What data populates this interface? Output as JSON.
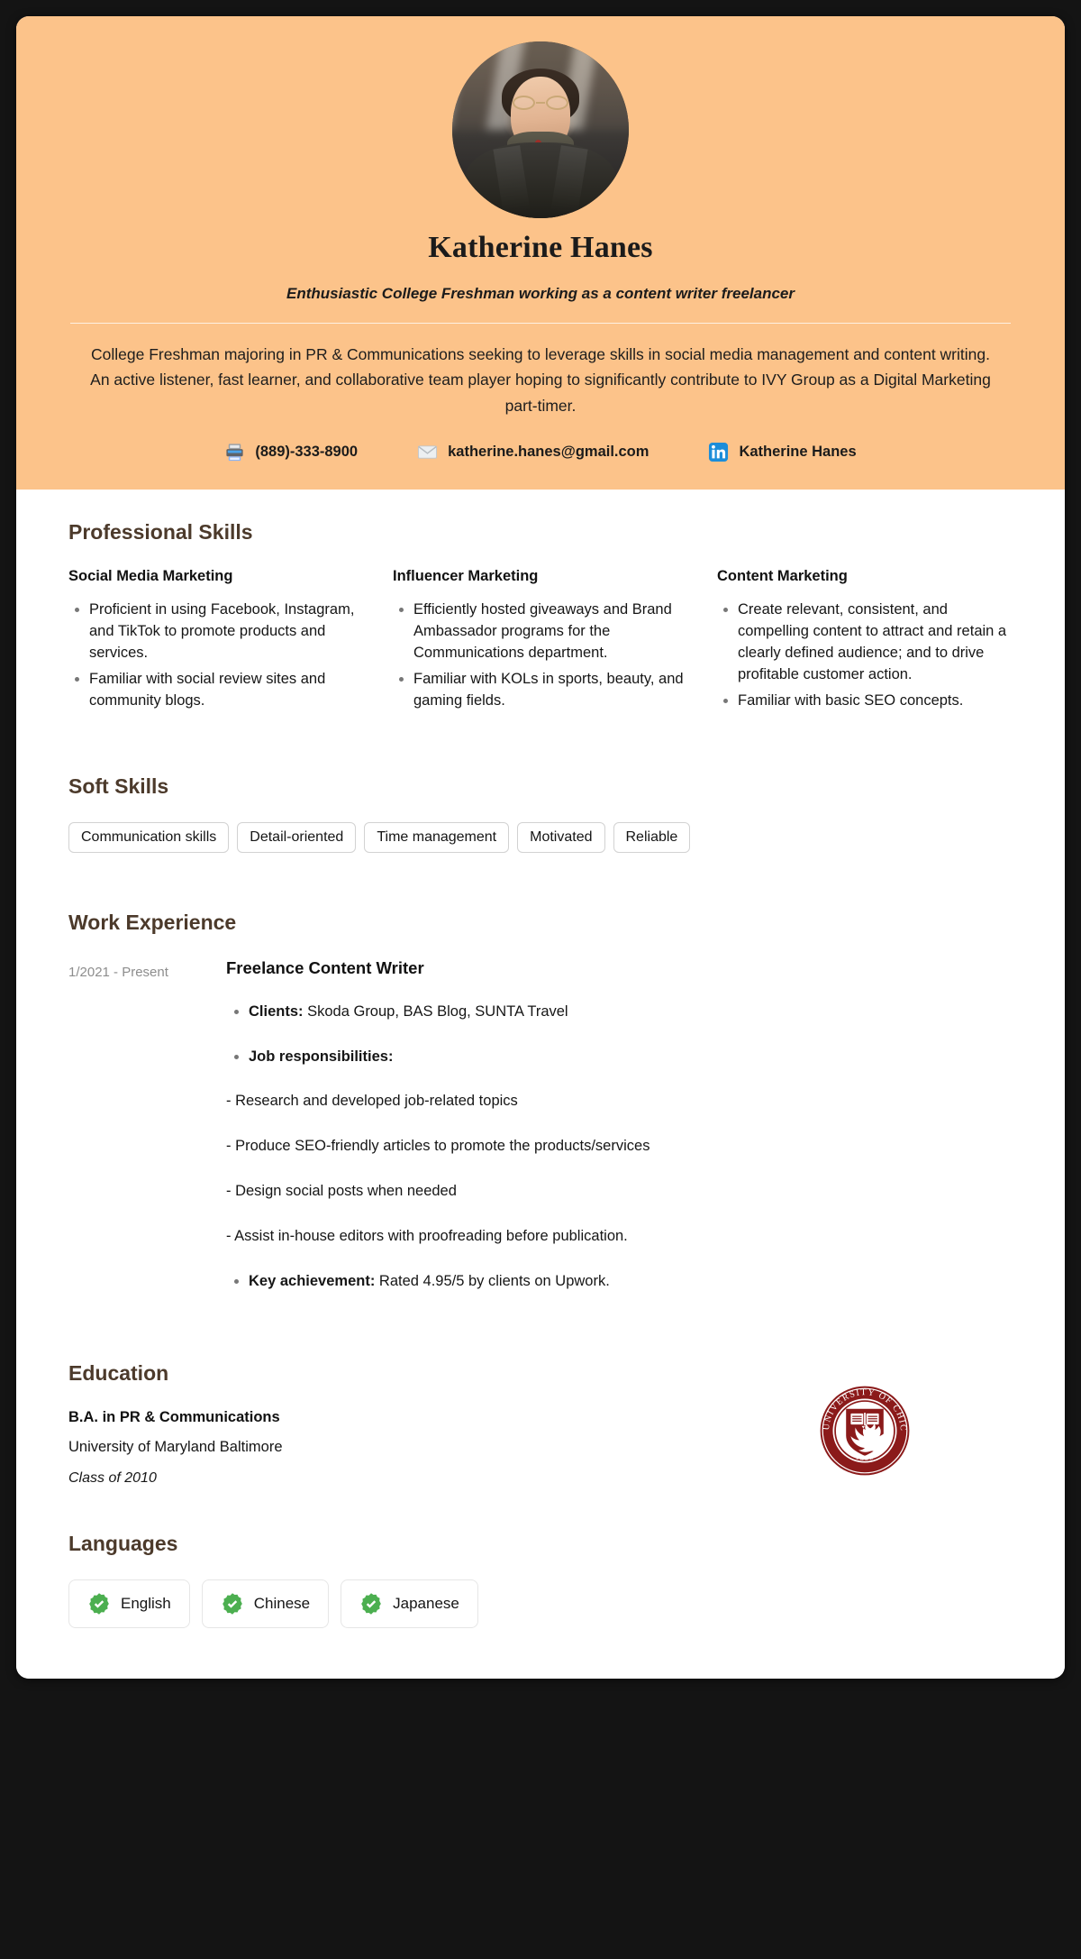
{
  "theme": {
    "header_bg": "#FCC38A",
    "page_bg": "#FFFFFF",
    "frame_bg": "#141414",
    "heading_color": "#4C3A2B",
    "accent_green": "#4CAF50",
    "linkedin_blue": "#0A84D8",
    "seal_maroon": "#8B1A1A"
  },
  "header": {
    "avatar_alt": "profile-photo",
    "name": "Katherine Hanes",
    "headline": "Enthusiastic College Freshman working as a content writer freelancer",
    "summary": "College Freshman majoring in PR & Communications seeking to leverage skills in social media management and content writing. An active listener, fast learner, and collaborative team player hoping to significantly contribute to IVY Group as a Digital Marketing part-timer.",
    "contacts": [
      {
        "icon": "fax-icon",
        "value": "(889)-333-8900"
      },
      {
        "icon": "email-icon",
        "value": "katherine.hanes@gmail.com"
      },
      {
        "icon": "linkedin-icon",
        "value": "Katherine Hanes"
      }
    ]
  },
  "professional_skills": {
    "title": "Professional Skills",
    "columns": [
      {
        "heading": "Social Media Marketing",
        "items": [
          "Proficient in using Facebook, Instagram, and TikTok to promote products and services.",
          "Familiar with social review sites and community blogs."
        ]
      },
      {
        "heading": "Influencer Marketing",
        "items": [
          "Efficiently hosted giveaways and Brand Ambassador programs for the Communications department.",
          "Familiar with KOLs in sports, beauty, and gaming fields."
        ]
      },
      {
        "heading": "Content Marketing",
        "items": [
          "Create relevant, consistent, and compelling content to attract and retain a clearly defined audience; and to drive profitable customer action.",
          "Familiar with basic SEO concepts."
        ]
      }
    ]
  },
  "soft_skills": {
    "title": "Soft Skills",
    "tags": [
      "Communication skills",
      "Detail-oriented",
      "Time management",
      "Motivated",
      "Reliable"
    ]
  },
  "work_experience": {
    "title": "Work Experience",
    "entries": [
      {
        "dates": "1/2021 - Present",
        "job_title": "Freelance Content Writer",
        "clients_label": "Clients:",
        "clients_value": "Skoda Group, BAS Blog, SUNTA Travel",
        "responsibilities_label": "Job responsibilities:",
        "responsibilities": [
          "- Research and developed job-related topics",
          "- Produce SEO-friendly articles to promote the products/services",
          "- Design social posts when needed",
          "- Assist in-house editors with proofreading before publication."
        ],
        "achievement_label": "Key achievement:",
        "achievement_value": "Rated 4.95/5 by clients on Upwork."
      }
    ]
  },
  "education": {
    "title": "Education",
    "degree": "B.A. in PR & Communications",
    "school": "University of Maryland Baltimore",
    "class_of": "Class of 2010",
    "seal": {
      "icon": "university-seal-icon",
      "outer_text": "THE UNIVERSITY OF CHICAGO",
      "year": "1890"
    }
  },
  "languages": {
    "title": "Languages",
    "items": [
      {
        "name": "English",
        "icon": "verified-check-icon"
      },
      {
        "name": "Chinese",
        "icon": "verified-check-icon"
      },
      {
        "name": "Japanese",
        "icon": "verified-check-icon"
      }
    ]
  }
}
